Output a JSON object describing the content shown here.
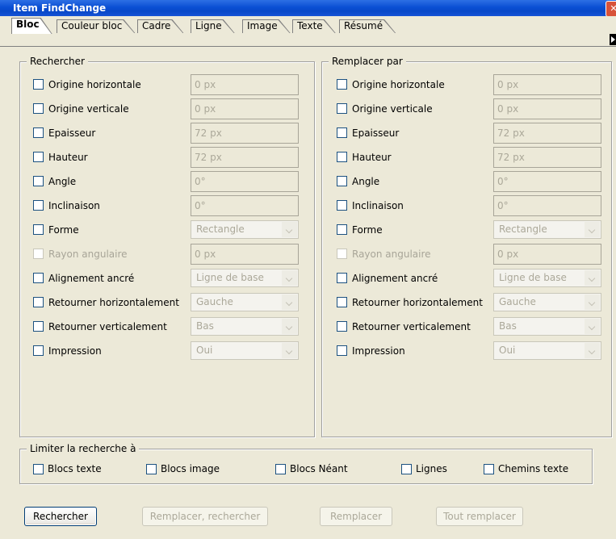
{
  "window": {
    "title": "Item FindChange",
    "close_glyph": "✕"
  },
  "tabs": [
    {
      "label": "Bloc",
      "active": true
    },
    {
      "label": "Couleur bloc",
      "active": false
    },
    {
      "label": "Cadre",
      "active": false
    },
    {
      "label": "Ligne",
      "active": false
    },
    {
      "label": "Image",
      "active": false
    },
    {
      "label": "Texte",
      "active": false
    },
    {
      "label": "Résumé",
      "active": false
    }
  ],
  "search": {
    "legend": "Rechercher",
    "rows": [
      {
        "label": "Origine horizontale",
        "control": "field",
        "value": "0 px",
        "checked": false,
        "enabled": true
      },
      {
        "label": "Origine verticale",
        "control": "field",
        "value": "0 px",
        "checked": false,
        "enabled": true
      },
      {
        "label": "Epaisseur",
        "control": "field",
        "value": "72 px",
        "checked": false,
        "enabled": true
      },
      {
        "label": "Hauteur",
        "control": "field",
        "value": "72 px",
        "checked": false,
        "enabled": true
      },
      {
        "label": "Angle",
        "control": "field",
        "value": "0°",
        "checked": false,
        "enabled": true
      },
      {
        "label": "Inclinaison",
        "control": "field",
        "value": "0°",
        "checked": false,
        "enabled": true
      },
      {
        "label": "Forme",
        "control": "select",
        "value": "Rectangle",
        "checked": false,
        "enabled": true
      },
      {
        "label": "Rayon angulaire",
        "control": "field",
        "value": "0 px",
        "checked": false,
        "enabled": false
      },
      {
        "label": "Alignement ancré",
        "control": "select",
        "value": "Ligne de base",
        "checked": false,
        "enabled": true
      },
      {
        "label": "Retourner horizontalement",
        "control": "select",
        "value": "Gauche",
        "checked": false,
        "enabled": true
      },
      {
        "label": "Retourner verticalement",
        "control": "select",
        "value": "Bas",
        "checked": false,
        "enabled": true
      },
      {
        "label": "Impression",
        "control": "select",
        "value": "Oui",
        "checked": false,
        "enabled": true
      }
    ]
  },
  "replace": {
    "legend": "Remplacer par",
    "rows": [
      {
        "label": "Origine horizontale",
        "control": "field",
        "value": "0 px",
        "checked": false,
        "enabled": true
      },
      {
        "label": "Origine verticale",
        "control": "field",
        "value": "0 px",
        "checked": false,
        "enabled": true
      },
      {
        "label": "Epaisseur",
        "control": "field",
        "value": "72 px",
        "checked": false,
        "enabled": true
      },
      {
        "label": "Hauteur",
        "control": "field",
        "value": "72 px",
        "checked": false,
        "enabled": true
      },
      {
        "label": "Angle",
        "control": "field",
        "value": "0°",
        "checked": false,
        "enabled": true
      },
      {
        "label": "Inclinaison",
        "control": "field",
        "value": "0°",
        "checked": false,
        "enabled": true
      },
      {
        "label": "Forme",
        "control": "select",
        "value": "Rectangle",
        "checked": false,
        "enabled": true
      },
      {
        "label": "Rayon angulaire",
        "control": "field",
        "value": "0 px",
        "checked": false,
        "enabled": false
      },
      {
        "label": "Alignement ancré",
        "control": "select",
        "value": "Ligne de base",
        "checked": false,
        "enabled": true
      },
      {
        "label": "Retourner horizontalement",
        "control": "select",
        "value": "Gauche",
        "checked": false,
        "enabled": true
      },
      {
        "label": "Retourner verticalement",
        "control": "select",
        "value": "Bas",
        "checked": false,
        "enabled": true
      },
      {
        "label": "Impression",
        "control": "select",
        "value": "Oui",
        "checked": false,
        "enabled": true
      }
    ]
  },
  "limit": {
    "legend": "Limiter la recherche à",
    "items": [
      {
        "label": "Blocs texte",
        "checked": false
      },
      {
        "label": "Blocs image",
        "checked": false
      },
      {
        "label": "Blocs Néant",
        "checked": false
      },
      {
        "label": "Lignes",
        "checked": false
      },
      {
        "label": "Chemins texte",
        "checked": false
      }
    ]
  },
  "buttons": [
    {
      "label": "Rechercher",
      "enabled": true
    },
    {
      "label": "Remplacer, rechercher",
      "enabled": false
    },
    {
      "label": "Remplacer",
      "enabled": false
    },
    {
      "label": "Tout remplacer",
      "enabled": false
    }
  ],
  "colors": {
    "title_bar": "#0A4FD4",
    "dialog_bg": "#ECE9D8",
    "checkbox_border": "#1C5180",
    "disabled_text": "#ABA899"
  }
}
